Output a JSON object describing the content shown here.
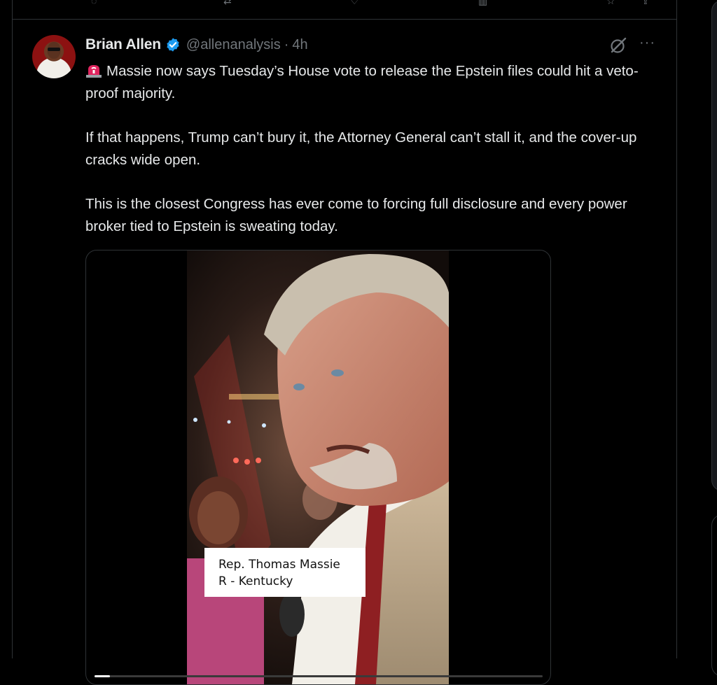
{
  "tweet": {
    "author_name": "Brian Allen",
    "handle": "@allenanalysis",
    "separator": "·",
    "time": "4h",
    "paragraphs": [
      "Massie now says Tuesday’s House vote to release the Epstein files could hit a veto-proof majority.",
      "If that happens, Trump can’t bury it, the Attorney General can’t stall it, and the cover-up cracks wide open.",
      "This is the closest Congress has ever come to forcing full disclosure and every power broker tied to Epstein is sweating today."
    ],
    "leading_emoji": "siren-emoji",
    "media": {
      "caption_line1": "Rep. Thomas Massie",
      "caption_line2": "R - Kentucky",
      "progress": 0.035
    }
  },
  "icons": {
    "verified": "verified-badge-icon",
    "grok": "grok-icon",
    "more": "more-icon"
  },
  "colors": {
    "background": "#000000",
    "text": "#e7e9ea",
    "muted": "#71767b",
    "border": "#2f3336",
    "verified": "#1d9bf0"
  }
}
